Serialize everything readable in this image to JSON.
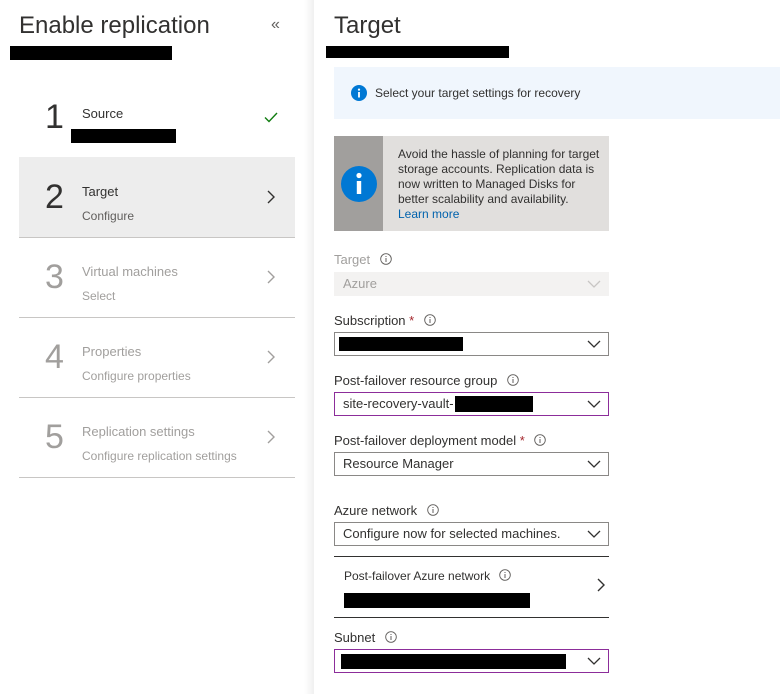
{
  "left": {
    "title": "Enable replication",
    "collapse_glyph": "«",
    "steps": [
      {
        "num": "1",
        "label": "Source",
        "sub": "",
        "status": "check-icon"
      },
      {
        "num": "2",
        "label": "Target",
        "sub": "Configure",
        "status": "chevron-right-icon"
      },
      {
        "num": "3",
        "label": "Virtual machines",
        "sub": "Select",
        "status": "chevron-right-icon"
      },
      {
        "num": "4",
        "label": "Properties",
        "sub": "Configure properties",
        "status": "chevron-right-icon"
      },
      {
        "num": "5",
        "label": "Replication settings",
        "sub": "Configure replication settings",
        "status": "chevron-right-icon"
      }
    ]
  },
  "right": {
    "title": "Target",
    "info_bar": "Select your target settings for recovery",
    "callout": {
      "text": "Avoid the hassle of planning for target storage accounts. Replication data is now written to Managed Disks for better scalability and availability.",
      "link": "Learn more"
    },
    "fields": {
      "target": {
        "label": "Target",
        "value": "Azure"
      },
      "subscription": {
        "label": "Subscription",
        "required": "*",
        "value": ""
      },
      "resource_group": {
        "label": "Post-failover resource group",
        "value": "site-recovery-vault-"
      },
      "deployment_model": {
        "label": "Post-failover deployment model",
        "required": "*",
        "value": "Resource Manager"
      },
      "azure_network": {
        "label": "Azure network",
        "value": "Configure now for selected machines."
      },
      "post_failover_network": {
        "label": "Post-failover Azure network"
      },
      "subnet": {
        "label": "Subnet",
        "value": ""
      }
    }
  },
  "colors": {
    "accent_link": "#0062ad",
    "info_blue": "#0078d4",
    "check_green": "#107c10",
    "required_red": "#a4262c",
    "focus_border": "#8c2d9a"
  }
}
